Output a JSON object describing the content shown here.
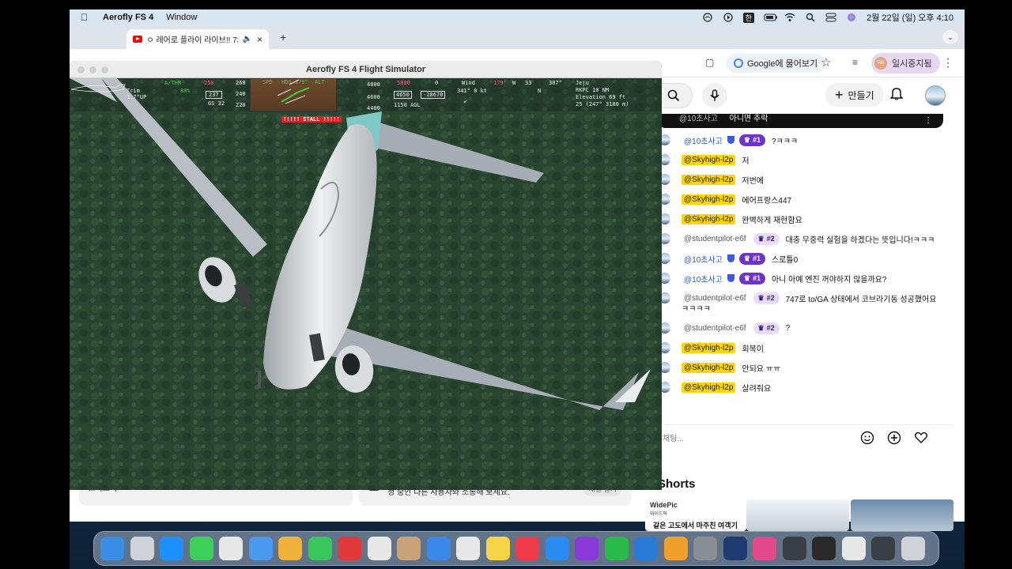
{
  "menubar": {
    "app_name": "Aerofly FS 4",
    "menu_window": "Window",
    "clock": "2월 22일 (일) 오후 4:10",
    "status_icons": [
      "cloud-icon",
      "play-circle-icon",
      "input-korean-icon",
      "battery-icon",
      "wifi-icon",
      "search-icon",
      "control-center-icon",
      "siri-icon"
    ],
    "input_label": "한"
  },
  "browser": {
    "tab_title": "ㅇ 레어로 플라이 라이브!! 739",
    "ask_google": "Google에 물어보기",
    "paused_label": "일시중지됨",
    "paused_avatar": "RB",
    "yt_create": "만들기",
    "more_label": "...더보기",
    "live_info": "청 중인 다른 사용자와 소통해 보세요.",
    "live_btn": "채널 열기",
    "shorts_title": "Shorts",
    "shorts_channel": "WidePic",
    "shorts_channel_sub": "와이드픽",
    "shorts_caption": "같은 고도에서 마주친 여객기"
  },
  "chat": {
    "pinned_user": "@10초사고",
    "pinned_text": "아니면 추락",
    "input_placeholder": "채팅...",
    "messages": [
      {
        "user": "@10초사고",
        "style": "mod",
        "badge": "#1",
        "text": "?ㅋㅋㅋ"
      },
      {
        "user": "@Skyhigh-l2p",
        "style": "hl",
        "badge": "",
        "text": "저"
      },
      {
        "user": "@Skyhigh-l2p",
        "style": "hl",
        "badge": "",
        "text": "저번에"
      },
      {
        "user": "@Skyhigh-l2p",
        "style": "hl",
        "badge": "",
        "text": "에어프랑스447"
      },
      {
        "user": "@Skyhigh-l2p",
        "style": "hl",
        "badge": "",
        "text": "완벽하게 재현함요"
      },
      {
        "user": "@studentpilot-e6f",
        "style": "plain",
        "badge": "#2",
        "text": "대충 무중력 실험을 하겠다는 뜻입니다!ㅋㅋㅋ"
      },
      {
        "user": "@10초사고",
        "style": "mod",
        "badge": "#1",
        "text": "스로틀0"
      },
      {
        "user": "@10초사고",
        "style": "mod",
        "badge": "#1",
        "text": "아니 아예 엔진 꺼야하지 않을까요?"
      },
      {
        "user": "@studentpilot-e6f",
        "style": "plain",
        "badge": "#2",
        "text": "747로 to/GA 상태에서 코브라기동 성공했어요",
        "wrap": "ㅋㅋㅋㅋ"
      },
      {
        "user": "@studentpilot-e6f",
        "style": "plain",
        "badge": "#2",
        "text": "?"
      },
      {
        "user": "@Skyhigh-l2p",
        "style": "hl",
        "badge": "",
        "text": "회복이"
      },
      {
        "user": "@Skyhigh-l2p",
        "style": "hl",
        "badge": "",
        "text": "안되요 ㅠㅠ"
      },
      {
        "user": "@Skyhigh-l2p",
        "style": "hl",
        "badge": "",
        "text": "살려줘요"
      }
    ]
  },
  "aerofly": {
    "window_title": "Aerofly FS 4 Flight Simulator",
    "hud": {
      "trim_label": "Trim",
      "trim_value": "1.7°UP",
      "athr": "A/THR",
      "athr_pct": "88%",
      "gs": "GS 32",
      "speed": "237",
      "spd_tape": [
        "260",
        "250",
        "240",
        "220"
      ],
      "hdg": "HDG 179°",
      "spd_label": "SPD",
      "alt_label": "ALT",
      "alt_tape": [
        "4800",
        "4600",
        "4400"
      ],
      "alt_value": "4650",
      "vs": "-28670",
      "alt_sel": "5800",
      "agl": "1150 AGL",
      "wind_label": "Wind",
      "wind_value": "341° 0 kt",
      "compass": "179°",
      "compass_marks": [
        "W",
        "33",
        "N",
        "307°"
      ],
      "airport": "Jeju",
      "runway": "RKPC 10 NM",
      "elevation": "Elevation 69 ft",
      "rwy_info": "25 (247° 3180 m)",
      "stall": "!!!!! STALL !!!!!",
      "zero": "0"
    }
  },
  "colors": {
    "accent_badge1": "#6e33c8",
    "highlight_user": "#ffd600",
    "stall_red": "#e02020",
    "hud_green": "#40d040"
  }
}
